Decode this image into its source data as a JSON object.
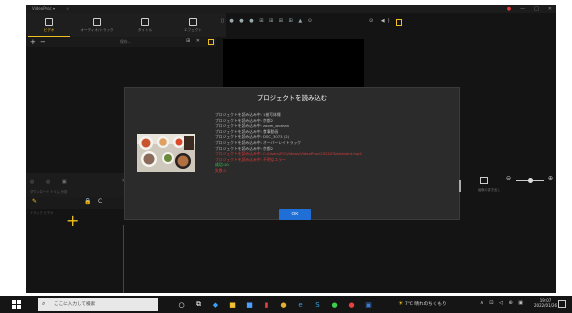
{
  "window": {
    "app_title": "VideoProc ▾",
    "tab_close": "×"
  },
  "window_controls": {
    "record": "●",
    "minimize": "—",
    "maximize": "□",
    "close": "✕"
  },
  "main_tabs": [
    {
      "label": "ビデオ",
      "icon": "video-icon",
      "active": true
    },
    {
      "label": "オーディオ/トラック",
      "icon": "audio-icon",
      "active": false
    },
    {
      "label": "タイトル",
      "icon": "title-icon",
      "active": false
    },
    {
      "label": "エフェクト",
      "icon": "effect-icon",
      "active": false
    }
  ],
  "left_toolbar": {
    "add": "+",
    "remove": "−"
  },
  "mid_toolbar": {
    "field": "保存...",
    "tools": "⊞ ✕"
  },
  "preview_toolbar": {
    "dots": "▯ ● ● ● ⊞ ⊞ ⊞  ⊞ ▲ ⊙",
    "right": "⊙ ◀)"
  },
  "lower_left": {
    "row1": "◎ ◎ ▣",
    "row2": "ダウンロード トリム 分割"
  },
  "track": {
    "label": "トラック ビデオ",
    "pen": "✎",
    "lock": "🔒",
    "mark": "C"
  },
  "right_panel": {
    "small": "画像の書き出し",
    "zoom_minus": "⊖",
    "zoom_plus": "⊕"
  },
  "dialog": {
    "title": "プロジェクトを読み込む",
    "log": [
      {
        "text": "プロジェクトを読み込み中: 1被写体撮",
        "status": "normal"
      },
      {
        "text": "プロジェクトを読み込み中: 京都2",
        "status": "normal"
      },
      {
        "text": "プロジェクトを読み込み中: zoom_woman",
        "status": "normal"
      },
      {
        "text": "プロジェクトを読み込み中: 食事動画",
        "status": "normal"
      },
      {
        "text": "プロジェクトを読み込み中: DSC_3073 (2)",
        "status": "normal"
      },
      {
        "text": "プロジェクトを読み込み中: オーバーレイトラック",
        "status": "normal"
      },
      {
        "text": "プロジェクトを読み込み中: 京都2",
        "status": "normal"
      },
      {
        "text": "プロジェクトを読み込み中: C:\\Users\\PC\\Videos\\VideoProc\\202203\\Ambient.mp4",
        "status": "error"
      },
      {
        "text": "プロジェクトを読み込み中: 不明なエラー",
        "status": "error"
      },
      {
        "text": "成功:10",
        "status": "success"
      },
      {
        "text": "失敗:2",
        "status": "error"
      }
    ],
    "ok_label": "OK"
  },
  "taskbar": {
    "search_placeholder": "ここに入力して検索",
    "apps": [
      {
        "name": "search-app-icon",
        "glyph": "○",
        "color": "#ffffff"
      },
      {
        "name": "task-view-icon",
        "glyph": "⧉",
        "color": "#ffffff"
      },
      {
        "name": "edge-icon",
        "glyph": "◆",
        "color": "#3aa0ff"
      },
      {
        "name": "folder-icon",
        "glyph": "■",
        "color": "#f2c230"
      },
      {
        "name": "store-icon",
        "glyph": "■",
        "color": "#4aa0ff"
      },
      {
        "name": "mail-icon",
        "glyph": "▮",
        "color": "#e84040"
      },
      {
        "name": "chrome-icon",
        "glyph": "●",
        "color": "#e8b030"
      },
      {
        "name": "edge-legacy-icon",
        "glyph": "e",
        "color": "#3a9bea"
      },
      {
        "name": "skype-icon",
        "glyph": "S",
        "color": "#2aa7e8"
      },
      {
        "name": "line-icon",
        "glyph": "●",
        "color": "#3ccf4e"
      },
      {
        "name": "videoproc-icon",
        "glyph": "●",
        "color": "#e84040"
      },
      {
        "name": "photos-icon",
        "glyph": "▣",
        "color": "#3a7ad8"
      }
    ],
    "weather": "7℃ 晴れのちくもり",
    "tray_icons": "∧ ⊡ ◁ ⊕ ▣",
    "time": "19:07",
    "date": "2022/01/26"
  }
}
